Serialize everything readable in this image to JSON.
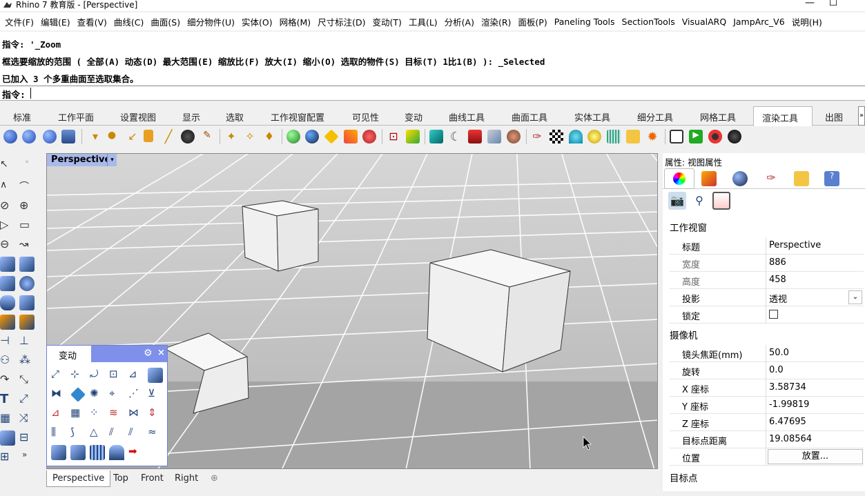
{
  "window": {
    "title": "Rhino 7 教育版 - [Perspective]",
    "minimize": "—",
    "maximize": "☐"
  },
  "menu": [
    "文件(F)",
    "编辑(E)",
    "查看(V)",
    "曲线(C)",
    "曲面(S)",
    "细分物件(U)",
    "实体(O)",
    "网格(M)",
    "尺寸标注(D)",
    "变动(T)",
    "工具(L)",
    "分析(A)",
    "渲染(R)",
    "面板(P)",
    "Paneling Tools",
    "SectionTools",
    "VisualARQ",
    "JampArc_V6",
    "说明(H)"
  ],
  "command_history": [
    "指令: '_Zoom",
    "框选要缩放的范围 ( 全部(A) 动态(D) 最大范围(E) 缩放比(F) 放大(I) 缩小(O) 选取的物件(S) 目标(T) 1比1(B) ): _Selected",
    "已加入 3 个多重曲面至选取集合。"
  ],
  "command_prompt": "指令:",
  "tabs": [
    "标准",
    "工作平面",
    "设置视图",
    "显示",
    "选取",
    "工作视窗配置",
    "可见性",
    "变动",
    "曲线工具",
    "曲面工具",
    "实体工具",
    "细分工具",
    "网格工具",
    "渲染工具",
    "出图"
  ],
  "active_tab": "渲染工具",
  "tabs_more": "»",
  "viewport": {
    "label": "Perspective",
    "dropdown": "▾"
  },
  "float_panel": {
    "title": "变动",
    "gear": "⚙",
    "close": "×"
  },
  "viewport_tabs": [
    "Perspective",
    "Top",
    "Front",
    "Right"
  ],
  "viewport_tab_add": "⊕",
  "properties": {
    "title": "属性: 视图属性",
    "section_viewport": "工作视窗",
    "viewport_rows": [
      {
        "key": "标题",
        "value": "Perspective"
      },
      {
        "key": "宽度",
        "value": "886"
      },
      {
        "key": "高度",
        "value": "458"
      },
      {
        "key": "投影",
        "value": "透视"
      },
      {
        "key": "锁定",
        "value": ""
      }
    ],
    "section_camera": "摄像机",
    "camera_rows": [
      {
        "key": "镜头焦距(mm)",
        "value": "50.0"
      },
      {
        "key": "旋转",
        "value": "0.0"
      },
      {
        "key": "X 座标",
        "value": "3.58734"
      },
      {
        "key": "Y 座标",
        "value": "-1.99819"
      },
      {
        "key": "Z 座标",
        "value": "6.47695"
      },
      {
        "key": "目标点距离",
        "value": "19.08564"
      },
      {
        "key": "位置",
        "value": "放置..."
      }
    ],
    "section_target": "目标点"
  },
  "colors": {
    "viewport_label_bg": "#a9b9e9",
    "panel_header": "#7f90ea",
    "ground": "#a4a4a4"
  }
}
